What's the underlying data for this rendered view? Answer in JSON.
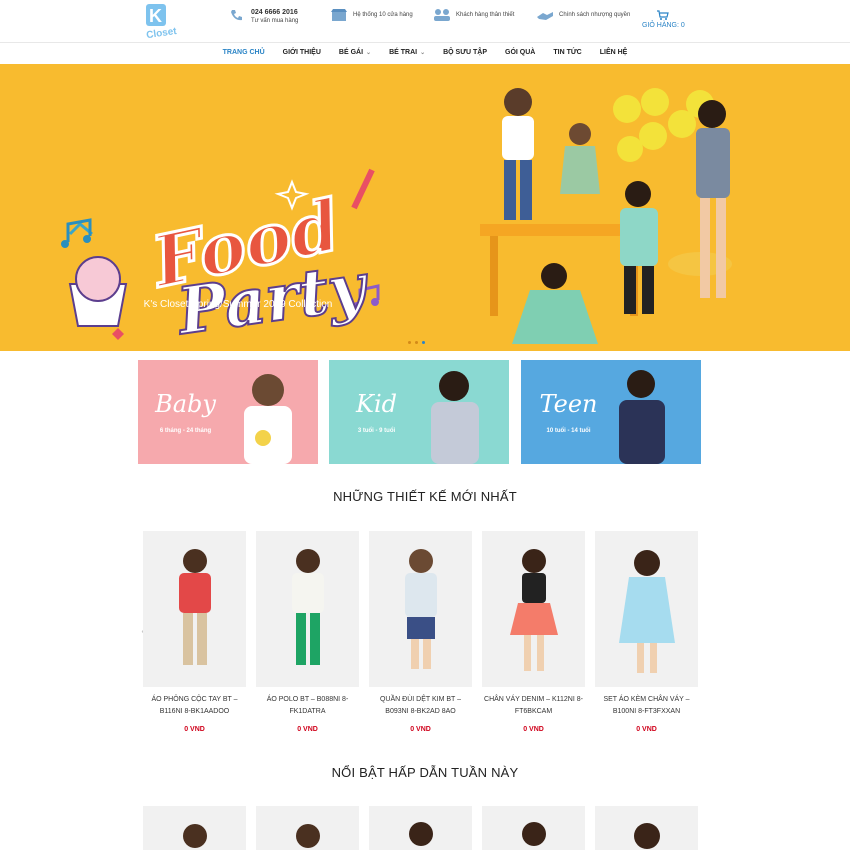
{
  "brand": {
    "logo_text": "K's Closet"
  },
  "header": {
    "hotline": {
      "phone": "024 6666 2016",
      "label": "Tư vấn mua hàng",
      "icon": "phone-icon"
    },
    "stores": {
      "label": "Hệ thống 10 cửa hàng",
      "icon": "store-icon"
    },
    "customers": {
      "label": "Khách hàng thân thiết",
      "icon": "users-icon"
    },
    "policy": {
      "label": "Chính sách nhượng quyền",
      "icon": "handshake-icon"
    },
    "cart": {
      "label": "GIỎ HÀNG:",
      "count": "0",
      "icon": "cart-icon"
    }
  },
  "nav": [
    {
      "label": "TRANG CHỦ",
      "active": true
    },
    {
      "label": "GIỚI THIỆU"
    },
    {
      "label": "BÉ GÁI",
      "caret": "⌄"
    },
    {
      "label": "BÉ TRAI",
      "caret": "⌄"
    },
    {
      "label": "BỘ SƯU TẬP"
    },
    {
      "label": "GÓI QUÀ"
    },
    {
      "label": "TIN TỨC"
    },
    {
      "label": "LIÊN HỆ"
    }
  ],
  "hero": {
    "title_line1": "Food",
    "title_line2": "Party",
    "subtitle": "K's Closet Spring/Summer 2019 Collection"
  },
  "categories": [
    {
      "name": "Baby",
      "age": "6 tháng - 24 tháng",
      "color": "#f6a9ad"
    },
    {
      "name": "Kid",
      "age": "3 tuổi - 9 tuổi",
      "color": "#8ad9d2"
    },
    {
      "name": "Teen",
      "age": "10 tuổi - 14 tuổi",
      "color": "#56a8e0"
    }
  ],
  "sections": {
    "new": "NHỮNG THIẾT KẾ MỚI NHẤT",
    "hot": "NỔI BẬT HẤP DẪN TUẦN NÀY"
  },
  "products": [
    {
      "name": "ÁO PHÔNG CỘC TAY BT – B116NI 8-BK1AADOO",
      "price": "0 VND"
    },
    {
      "name": "ÁO POLO BT – B088NI 8-FK1DATRA",
      "price": "0 VND"
    },
    {
      "name": "QUẦN ĐÙI DỆT KIM BT – B093NI 8-BK2AD 8AO",
      "price": "0 VND"
    },
    {
      "name": "CHÂN VÁY DENIM – K112NI 8-FT6BKCAM",
      "price": "0 VND"
    },
    {
      "name": "SET ÁO KÈM CHÂN VÁY – B100NI 8-FT3FXXAN",
      "price": "0 VND"
    }
  ],
  "arrows": {
    "prev": "‹",
    "next": "›"
  }
}
